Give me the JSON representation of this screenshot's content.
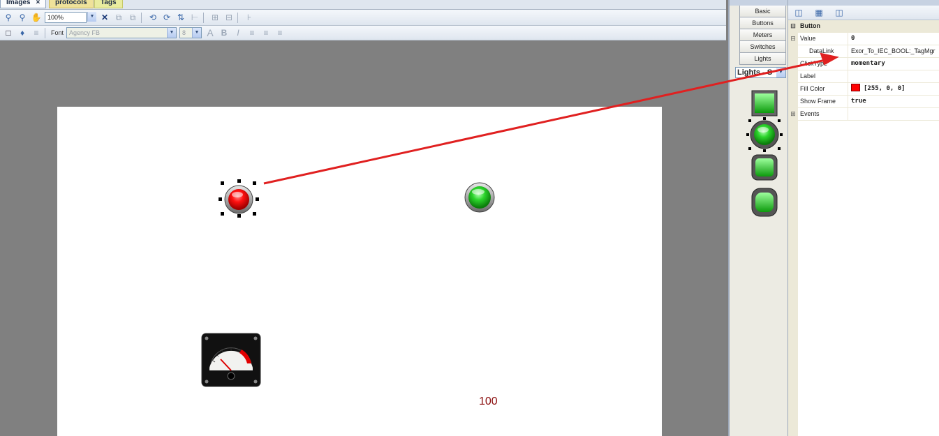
{
  "tabs": [
    {
      "label": "Images",
      "close": "×"
    },
    {
      "label": "protocols"
    },
    {
      "label": "Tags"
    }
  ],
  "toolbar": {
    "zoom_value": "100%",
    "font_label": "Font",
    "font_value": "Agency FB",
    "font_size_value": "8"
  },
  "palette": {
    "categories": [
      "Basic",
      "Buttons",
      "Meters",
      "Switches",
      "Lights"
    ],
    "dropdown_value": "Lights - S"
  },
  "properties": {
    "category": "Button",
    "rows": [
      {
        "name": "Value",
        "value": "0"
      },
      {
        "name": "DataLink",
        "value": "Exor_To_IEC_BOOL:_TagMgr"
      },
      {
        "name": "ClickType",
        "value": "momentary"
      },
      {
        "name": "Label",
        "value": ""
      },
      {
        "name": "Fill Color",
        "value": "[255, 0, 0]"
      },
      {
        "name": "Show Frame",
        "value": "true"
      },
      {
        "name": "Events",
        "value": ""
      }
    ]
  },
  "canvas": {
    "numeric_display": "100"
  },
  "colors": {
    "red_light": "#ff0000",
    "green_light": "#22c322",
    "annotation_arrow": "#e02020"
  }
}
